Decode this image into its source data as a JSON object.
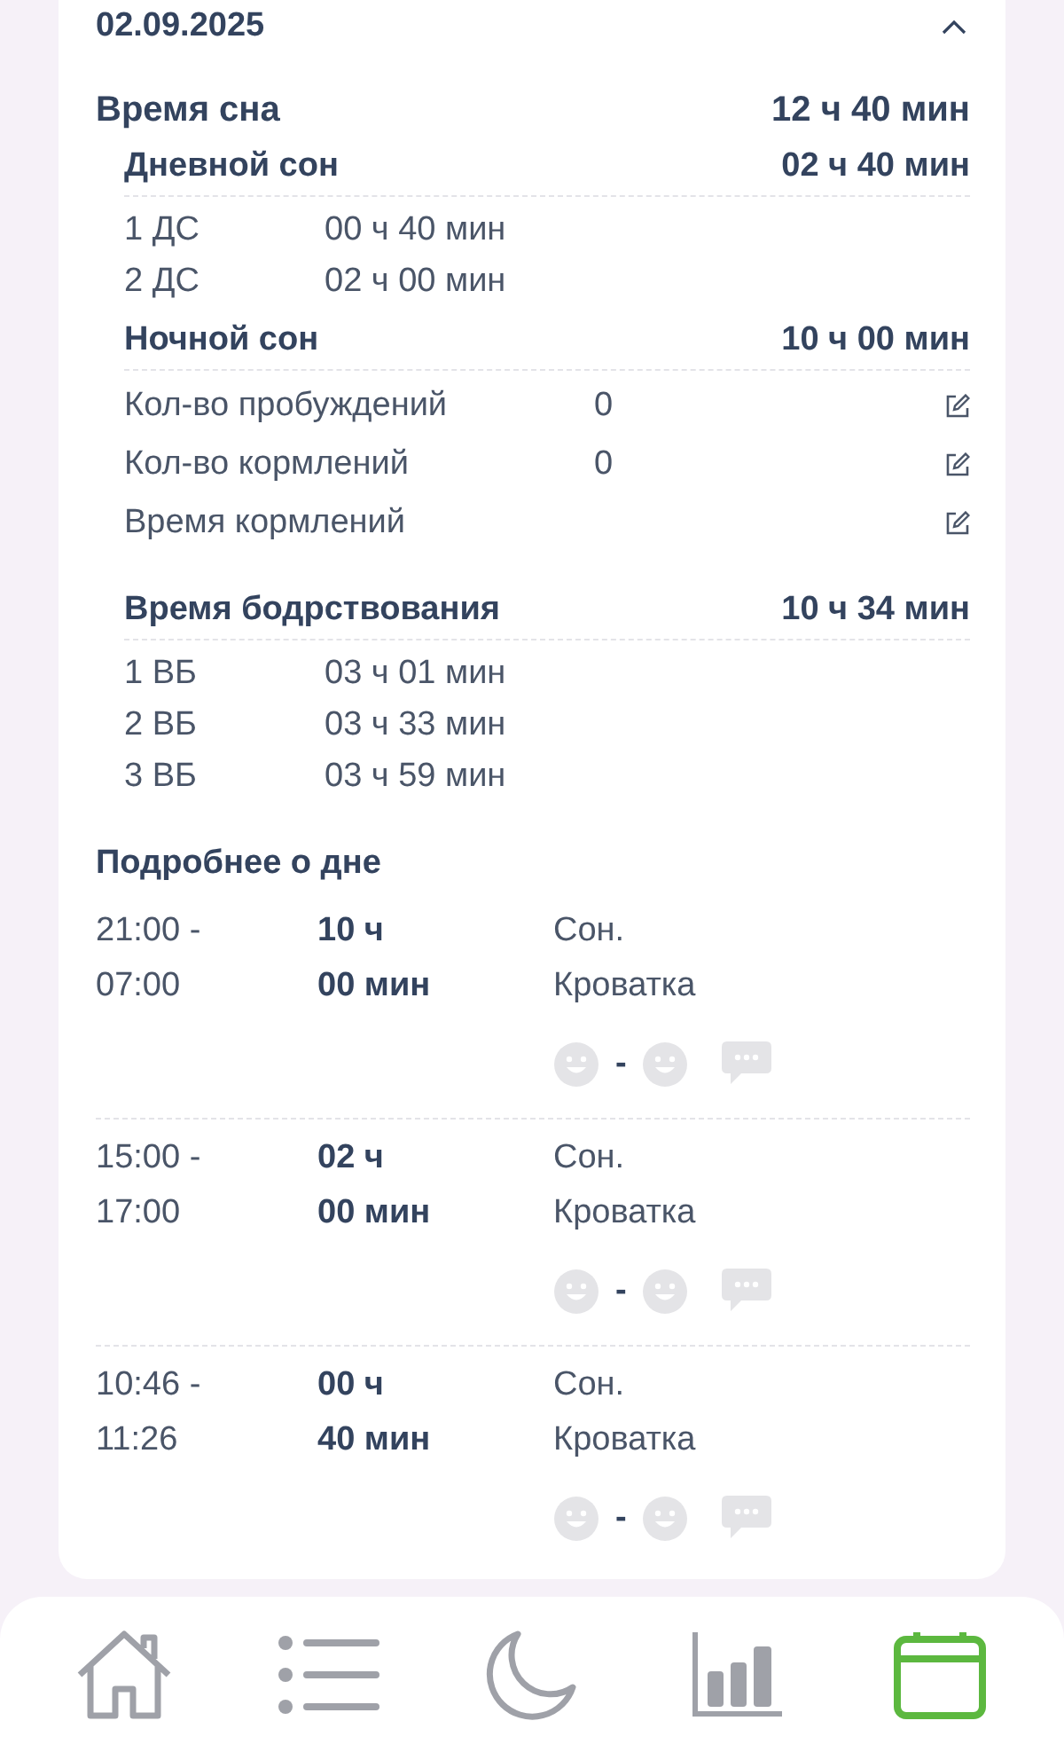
{
  "date": "02.09.2025",
  "expanded": true,
  "sleep": {
    "label": "Время сна",
    "total": "12 ч 40 мин"
  },
  "day_sleep": {
    "label": "Дневной сон",
    "total": "02 ч 40 мин",
    "items": [
      {
        "label": "1 ДС",
        "value": "00 ч 40 мин"
      },
      {
        "label": "2 ДС",
        "value": "02 ч 00 мин"
      }
    ]
  },
  "night_sleep": {
    "label": "Ночной сон",
    "total": "10 ч 00 мин",
    "stats": [
      {
        "label": "Кол-во пробуждений",
        "value": "0"
      },
      {
        "label": "Кол-во кормлений",
        "value": "0"
      },
      {
        "label": "Время кормлений"
      }
    ]
  },
  "wake": {
    "label": "Время бодрствования",
    "total": "10 ч 34 мин",
    "items": [
      {
        "label": "1 ВБ",
        "value": "03 ч 01 мин"
      },
      {
        "label": "2 ВБ",
        "value": "03 ч 33 мин"
      },
      {
        "label": "3 ВБ",
        "value": "03 ч 59 мин"
      }
    ]
  },
  "details": {
    "title": "Подробнее о дне",
    "entries": [
      {
        "start": "21:00 -",
        "end": "07:00",
        "hours": "10 ч",
        "minutes": "00 мин",
        "activity": "Сон.",
        "place": "Кроватка"
      },
      {
        "start": "15:00 -",
        "end": "17:00",
        "hours": "02 ч",
        "minutes": "00 мин",
        "activity": "Сон.",
        "place": "Кроватка"
      },
      {
        "start": "10:46 -",
        "end": "11:26",
        "hours": "00 ч",
        "minutes": "40 мин",
        "activity": "Сон.",
        "place": "Кроватка"
      }
    ]
  },
  "mood_separator": "-",
  "nav": [
    {
      "kind": "home",
      "selected": false
    },
    {
      "kind": "list",
      "selected": false
    },
    {
      "kind": "moon",
      "selected": false
    },
    {
      "kind": "chart",
      "selected": false
    },
    {
      "kind": "calendar",
      "selected": true
    }
  ]
}
